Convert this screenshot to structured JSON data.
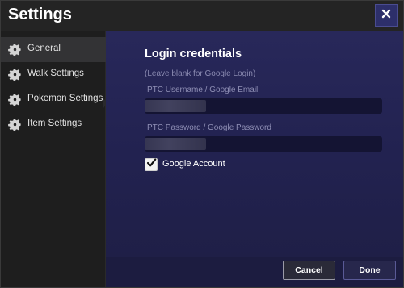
{
  "window": {
    "title": "Settings",
    "close_icon": "close-icon"
  },
  "sidebar": {
    "items": [
      {
        "label": "General",
        "icon": "gear-icon",
        "active": true
      },
      {
        "label": "Walk Settings",
        "icon": "gear-icon",
        "active": false
      },
      {
        "label": "Pokemon Settings",
        "icon": "gear-icon",
        "active": false
      },
      {
        "label": "Item Settings",
        "icon": "gear-icon",
        "active": false
      }
    ]
  },
  "main": {
    "section_title": "Login credentials",
    "hint": "(Leave blank for Google Login)",
    "username": {
      "label": "PTC Username / Google Email",
      "value": ""
    },
    "password": {
      "label": "PTC Password / Google Password",
      "value": ""
    },
    "google_account": {
      "label": "Google Account",
      "checked": true
    }
  },
  "footer": {
    "cancel_label": "Cancel",
    "done_label": "Done"
  },
  "colors": {
    "content_bg": "#24244f",
    "sidebar_bg": "#1e1e1e",
    "titlebar_bg": "#242424",
    "accent_close": "#2d2f6a"
  }
}
